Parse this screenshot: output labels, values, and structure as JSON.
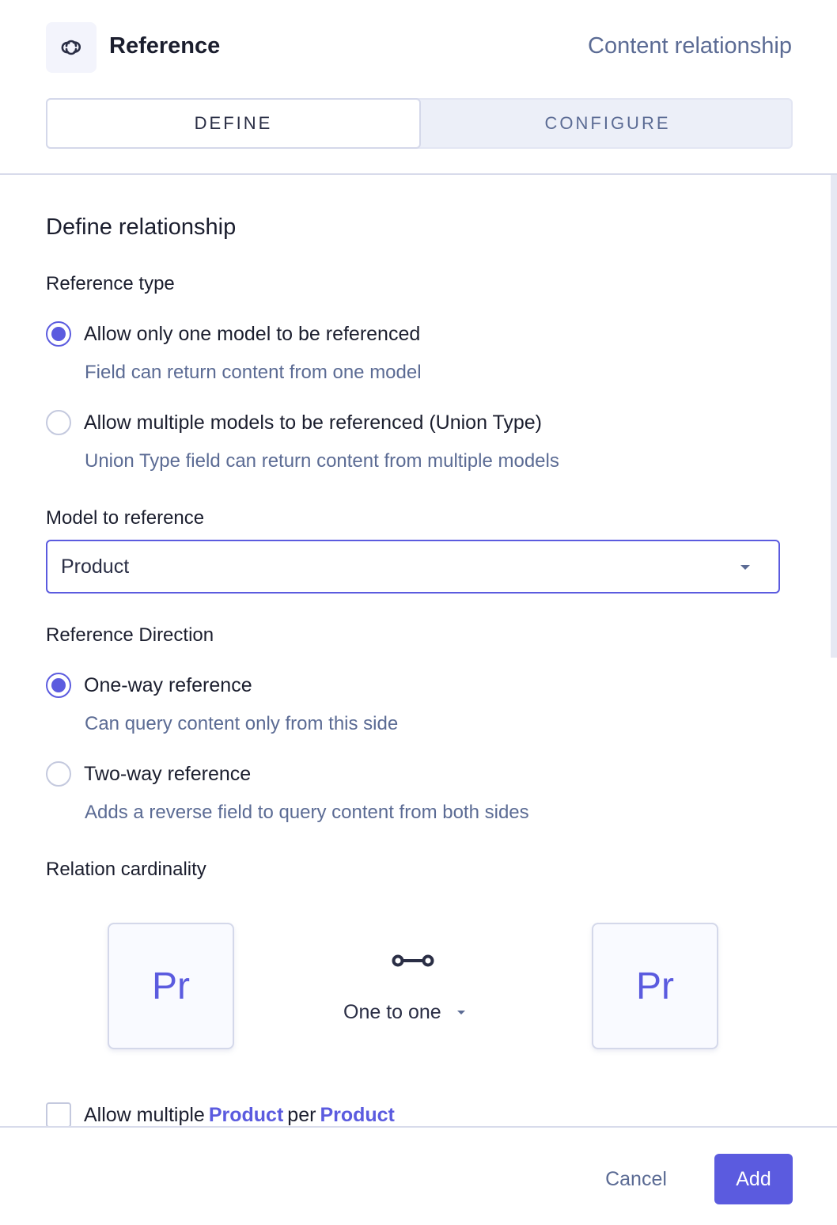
{
  "header": {
    "icon": "link-icon",
    "title": "Reference",
    "subtitle": "Content relationship"
  },
  "tabs": [
    {
      "label": "DEFINE",
      "active": true
    },
    {
      "label": "CONFIGURE",
      "active": false
    }
  ],
  "section_title": "Define relationship",
  "reference_type": {
    "label": "Reference type",
    "options": [
      {
        "label": "Allow only one model to be referenced",
        "description": "Field can return content from one model",
        "checked": true
      },
      {
        "label": "Allow multiple models to be referenced (Union Type)",
        "description": "Union Type field can return content from multiple models",
        "checked": false
      }
    ]
  },
  "model_to_reference": {
    "label": "Model to reference",
    "value": "Product",
    "caret_icon": "caret-down-icon"
  },
  "reference_direction": {
    "label": "Reference Direction",
    "options": [
      {
        "label": "One-way reference",
        "description": "Can query content only from this side",
        "checked": true
      },
      {
        "label": "Two-way reference",
        "description": "Adds a reverse field to query content from both sides",
        "checked": false
      }
    ]
  },
  "relation_cardinality": {
    "label": "Relation cardinality",
    "left_model_abbr": "Pr",
    "right_model_abbr": "Pr",
    "icon": "one-to-one-icon",
    "value": "One to one"
  },
  "allow_multiple": {
    "prefix": "Allow multiple",
    "model_a": "Product",
    "middle": "per",
    "model_b": "Product",
    "checked": false
  },
  "footer": {
    "cancel_label": "Cancel",
    "add_label": "Add"
  },
  "colors": {
    "accent": "#5b5bdf",
    "muted_text": "#5b6b94",
    "primary_text": "#1b1e2e",
    "border": "#d4d8ea"
  }
}
